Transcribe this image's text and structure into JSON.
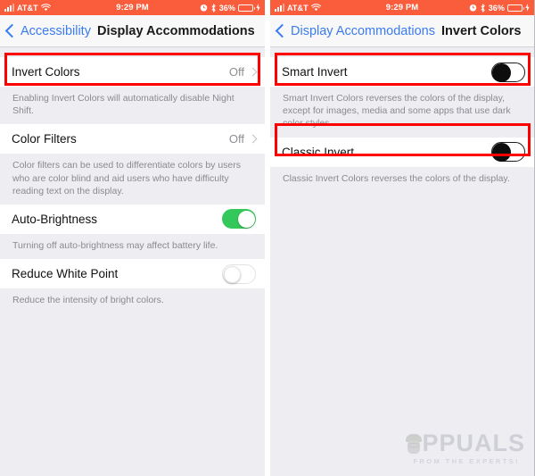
{
  "status_bar": {
    "carrier": "AT&T",
    "signal_icon": "signal-bars-icon",
    "wifi_icon": "wifi-icon",
    "time": "9:29 PM",
    "alarm_icon": "alarm-clock-icon",
    "bluetooth_icon": "bluetooth-icon",
    "battery_percent": "36%",
    "battery_icon": "battery-icon",
    "charging_icon": "charging-bolt-icon",
    "background_color": "#F95D3C"
  },
  "colors": {
    "accent_blue": "#3A7BF0",
    "toggle_on_green": "#34C759",
    "highlight_red": "#FF0000",
    "page_background": "#EDEDF2",
    "cell_background": "#FFFFFF"
  },
  "left_panel": {
    "nav": {
      "back_label": "Accessibility",
      "back_icon": "chevron-left-icon",
      "title": "Display Accommodations"
    },
    "rows": [
      {
        "label": "Invert Colors",
        "value": "Off",
        "accessory": "chevron-right-icon",
        "footnote": "Enabling Invert Colors will automatically disable Night Shift.",
        "highlighted": true
      },
      {
        "label": "Color Filters",
        "value": "Off",
        "accessory": "chevron-right-icon",
        "footnote": "Color filters can be used to differentiate colors by users who are color blind and aid users who have difficulty reading text on the display.",
        "highlighted": false
      },
      {
        "label": "Auto-Brightness",
        "accessory": "toggle-on",
        "footnote": "Turning off auto-brightness may affect battery life.",
        "highlighted": false
      },
      {
        "label": "Reduce White Point",
        "accessory": "toggle-off",
        "footnote": "Reduce the intensity of bright colors.",
        "highlighted": false
      }
    ]
  },
  "right_panel": {
    "nav": {
      "back_label": "Display Accommodations",
      "back_icon": "chevron-left-icon",
      "title": "Invert Colors"
    },
    "rows": [
      {
        "label": "Smart Invert",
        "accessory": "toggle-inverted",
        "footnote": "Smart Invert Colors reverses the colors of the display, except for images, media and some apps that use dark color styles.",
        "highlighted": true
      },
      {
        "label": "Classic Invert",
        "accessory": "toggle-inverted",
        "footnote": "Classic Invert Colors reverses the colors of the display.",
        "highlighted": true
      }
    ]
  },
  "watermark": {
    "brand": "PPUALS",
    "tagline": "FROM THE EXPERTS!",
    "mascot_icon": "appuals-mascot-icon"
  }
}
